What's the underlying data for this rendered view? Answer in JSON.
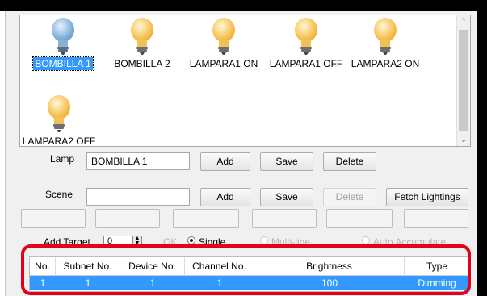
{
  "lamps": [
    {
      "label": "BOMBILLA 1",
      "selected": true,
      "color": "blue"
    },
    {
      "label": "BOMBILLA 2",
      "selected": false,
      "color": "yellow"
    },
    {
      "label": "LAMPARA1 ON",
      "selected": false,
      "color": "yellow"
    },
    {
      "label": "LAMPARA1 OFF",
      "selected": false,
      "color": "yellow"
    },
    {
      "label": "LAMPARA2 ON",
      "selected": false,
      "color": "yellow"
    },
    {
      "label": "LAMPARA2 OFF",
      "selected": false,
      "color": "yellow"
    }
  ],
  "lamp_row": {
    "label": "Lamp",
    "value": "BOMBILLA 1",
    "add": "Add",
    "save": "Save",
    "delete": "Delete"
  },
  "scene_row": {
    "label": "Scene",
    "value": "",
    "add": "Add",
    "save": "Save",
    "delete": "Delete",
    "fetch": "Fetch Lightings"
  },
  "target_row": {
    "add_target": "Add Target",
    "value": "0",
    "ok": "OK",
    "single": "Single",
    "multi": "Multi-line",
    "auto": "Auto Accumulate"
  },
  "table": {
    "headers": [
      "No.",
      "Subnet No.",
      "Device No.",
      "Channel No.",
      "Brightness",
      "Type"
    ],
    "rows": [
      [
        "1",
        "1",
        "1",
        "1",
        "100",
        "Dimming"
      ]
    ]
  },
  "colors": {
    "selection": "#3399ff",
    "highlight": "#e3001b",
    "bulb_yellow": "#ffd75e",
    "bulb_blue": "#7fb3e0"
  }
}
